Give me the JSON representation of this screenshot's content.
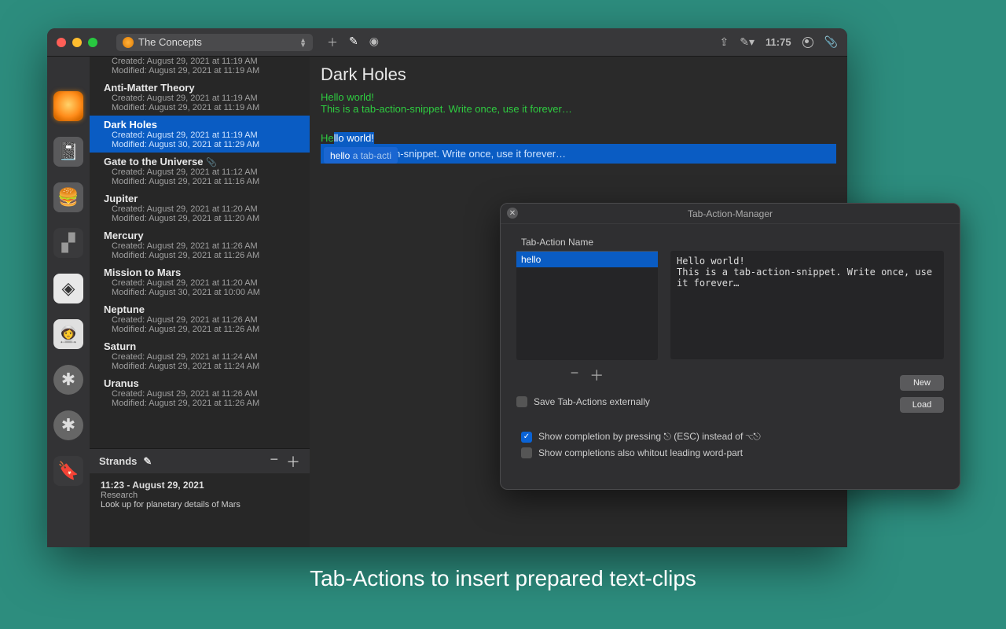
{
  "titlebar": {
    "doc_dropdown": "The Concepts",
    "clock": "11:75"
  },
  "notes": [
    {
      "title": "",
      "created": "Created: August 29, 2021 at 11:19 AM",
      "modified": "Modified: August 29, 2021 at 11:19 AM",
      "partial_top": true
    },
    {
      "title": "Anti-Matter Theory",
      "created": "Created: August 29, 2021 at 11:19 AM",
      "modified": "Modified: August 29, 2021 at 11:19 AM"
    },
    {
      "title": "Dark Holes",
      "created": "Created: August 29, 2021 at 11:19 AM",
      "modified": "Modified: August 30, 2021 at 11:29 AM",
      "selected": true
    },
    {
      "title": "Gate to the Universe",
      "created": "Created: August 29, 2021 at 11:12 AM",
      "modified": "Modified: August 29, 2021 at 11:16 AM",
      "attach": true
    },
    {
      "title": "Jupiter",
      "created": "Created: August 29, 2021 at 11:20 AM",
      "modified": "Modified: August 29, 2021 at 11:20 AM"
    },
    {
      "title": "Mercury",
      "created": "Created: August 29, 2021 at 11:26 AM",
      "modified": "Modified: August 29, 2021 at 11:26 AM"
    },
    {
      "title": "Mission to Mars",
      "created": "Created: August 29, 2021 at 11:20 AM",
      "modified": "Modified: August 30, 2021 at 10:00 AM"
    },
    {
      "title": "Neptune",
      "created": "Created: August 29, 2021 at 11:26 AM",
      "modified": "Modified: August 29, 2021 at 11:26 AM"
    },
    {
      "title": "Saturn",
      "created": "Created: August 29, 2021 at 11:24 AM",
      "modified": "Modified: August 29, 2021 at 11:24 AM"
    },
    {
      "title": "Uranus",
      "created": "Created: August 29, 2021 at 11:26 AM",
      "modified": "Modified: August 29, 2021 at 11:26 AM"
    }
  ],
  "strands": {
    "header": "Strands",
    "item": {
      "time": "11:23 - August 29, 2021",
      "category": "Research",
      "body": "Look up for planetary details of Mars"
    }
  },
  "editor": {
    "title": "Dark Holes",
    "line1": "Hello world!",
    "line2": "This is a tab-action-snippet. Write once, use it forever…",
    "line3_prefix": "He",
    "line3_sel": "llo world!",
    "autocomplete_text": "hello",
    "autocomplete_faded": " a tab-acti",
    "line4_rest": "n-snippet. Write once, use it forever…"
  },
  "popup": {
    "title": "Tab-Action-Manager",
    "col_header": "Tab-Action Name",
    "selected_name": "hello",
    "preview": "Hello world!\nThis is a tab-action-snippet. Write once, use it forever…",
    "save_external": "Save Tab-Actions externally",
    "btn_new": "New",
    "btn_load": "Load",
    "check1": "Show completion by pressing ⎋ (ESC) instead of ⌥⎋",
    "check2": "Show completions also whitout leading word-part"
  },
  "caption": "Tab-Actions to insert prepared text-clips"
}
